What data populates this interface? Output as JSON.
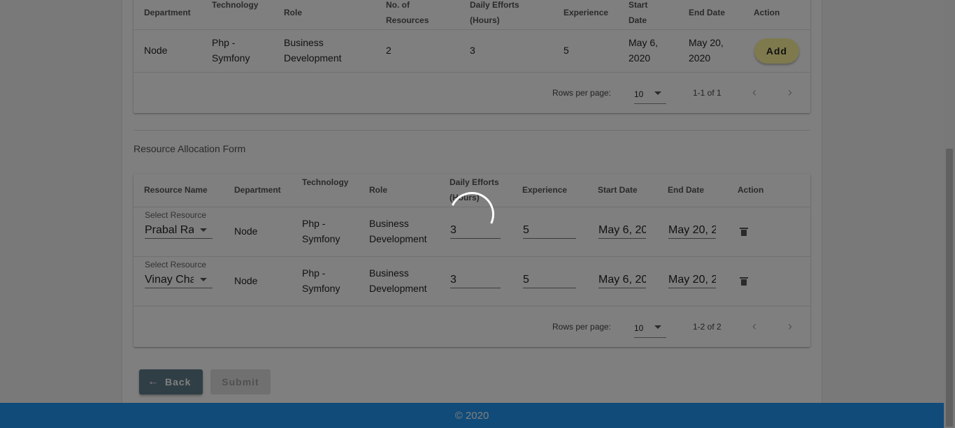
{
  "requirements_table": {
    "headers": {
      "department": "Department",
      "technology": "Technology",
      "role": "Role",
      "no_of_resources_line1": "No. of",
      "no_of_resources_line2": "Resources",
      "daily_efforts_line1": "Daily Efforts",
      "daily_efforts_line2": "(Hours)",
      "experience": "Experience",
      "start_date_line1": "Start",
      "start_date_line2": "Date",
      "end_date": "End Date",
      "action": "Action"
    },
    "row": {
      "department": "Node",
      "technology_line1": "Php -",
      "technology_line2": "Symfony",
      "role_line1": "Business",
      "role_line2": "Development",
      "no_of_resources": "2",
      "daily_efforts": "3",
      "experience": "5",
      "start_date_line1": "May 6,",
      "start_date_line2": "2020",
      "end_date_line1": "May 20,",
      "end_date_line2": "2020",
      "action_label": "Add"
    },
    "pagination": {
      "rows_per_page_label": "Rows per page:",
      "rows_per_page_value": "10",
      "range": "1-1 of 1"
    }
  },
  "allocation_form": {
    "title": "Resource Allocation Form",
    "headers": {
      "resource_name": "Resource Name",
      "department": "Department",
      "technology": "Technology",
      "role": "Role",
      "daily_efforts_line1": "Daily Efforts",
      "daily_efforts_line2": "(Hours)",
      "experience": "Experience",
      "start_date": "Start Date",
      "end_date": "End Date",
      "action": "Action"
    },
    "rows": [
      {
        "select_label": "Select Resource",
        "resource": "Prabal Ra",
        "department": "Node",
        "technology_line1": "Php -",
        "technology_line2": "Symfony",
        "role_line1": "Business",
        "role_line2": "Development",
        "daily_efforts": "3",
        "experience": "5",
        "start_date": "May 6, 20",
        "end_date": "May 20, 2"
      },
      {
        "select_label": "Select Resource",
        "resource": "Vinay Cha",
        "department": "Node",
        "technology_line1": "Php -",
        "technology_line2": "Symfony",
        "role_line1": "Business",
        "role_line2": "Development",
        "daily_efforts": "3",
        "experience": "5",
        "start_date": "May 6, 20",
        "end_date": "May 20, 2"
      }
    ],
    "pagination": {
      "rows_per_page_label": "Rows per page:",
      "rows_per_page_value": "10",
      "range": "1-2 of 2"
    }
  },
  "buttons": {
    "back": "Back",
    "submit": "Submit"
  },
  "footer": {
    "text": "© 2020"
  },
  "icons": {
    "back": "arrow-left-icon",
    "delete": "trash-icon",
    "prev": "chevron-left-icon",
    "next": "chevron-right-icon",
    "dropdown": "caret-down-icon",
    "loading": "spinner-icon"
  },
  "colors": {
    "add_button": "#fff59d",
    "back_button": "#607d8b",
    "footer": "#2196f3",
    "overlay": "rgba(0,0,0,0.5)"
  }
}
